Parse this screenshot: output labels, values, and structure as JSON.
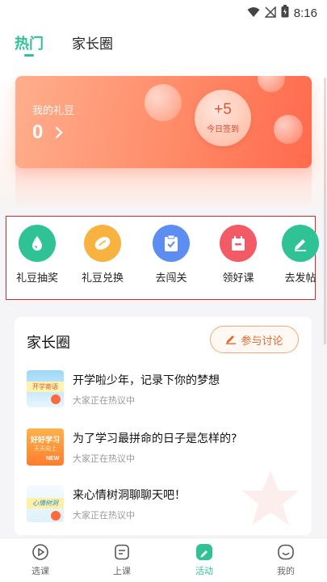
{
  "status_bar": {
    "time": "8:16"
  },
  "top_tabs": [
    {
      "label": "热门",
      "active": true
    },
    {
      "label": "家长圈",
      "active": false
    }
  ],
  "hero": {
    "label": "我的礼豆",
    "value": "0",
    "checkin_plus": "+5",
    "checkin_text": "今日签到"
  },
  "quick_actions": [
    {
      "label": "礼豆抽奖",
      "icon": "drop-icon",
      "color": "#2fc295"
    },
    {
      "label": "礼豆兑换",
      "icon": "bean-icon",
      "color": "#f7b23f"
    },
    {
      "label": "去闯关",
      "icon": "clipboard-check-icon",
      "color": "#5b8ef0"
    },
    {
      "label": "领好课",
      "icon": "gift-box-icon",
      "color": "#f25b65"
    },
    {
      "label": "去发帖",
      "icon": "pencil-icon",
      "color": "#2fc295"
    }
  ],
  "parents_circle": {
    "title": "家长圈",
    "discuss_label": "参与讨论",
    "posts": [
      {
        "title": "开学啦少年，记录下你的梦想",
        "subtitle": "大家正在热议中",
        "thumb_text": "开学寄语"
      },
      {
        "title": "为了学习最拼命的日子是怎样的?",
        "subtitle": "大家正在热议中",
        "thumb_text": "好好学习",
        "thumb_sub": "天天向上",
        "thumb_badge": "NEW"
      },
      {
        "title": "来心情树洞聊聊天吧！",
        "subtitle": "大家正在热议中",
        "thumb_text": "心情树洞"
      }
    ]
  },
  "bottom_nav": [
    {
      "label": "选课",
      "icon": "play-circle-icon",
      "active": false
    },
    {
      "label": "上课",
      "icon": "notebook-icon",
      "active": false
    },
    {
      "label": "活动",
      "icon": "activity-icon",
      "active": true
    },
    {
      "label": "我的",
      "icon": "smile-icon",
      "active": false
    }
  ],
  "colors": {
    "accent": "#2fc295",
    "hero_start": "#ffae8c",
    "hero_end": "#ff6a4c",
    "highlight_border": "#d02a2a",
    "discuss": "#e06a32"
  }
}
